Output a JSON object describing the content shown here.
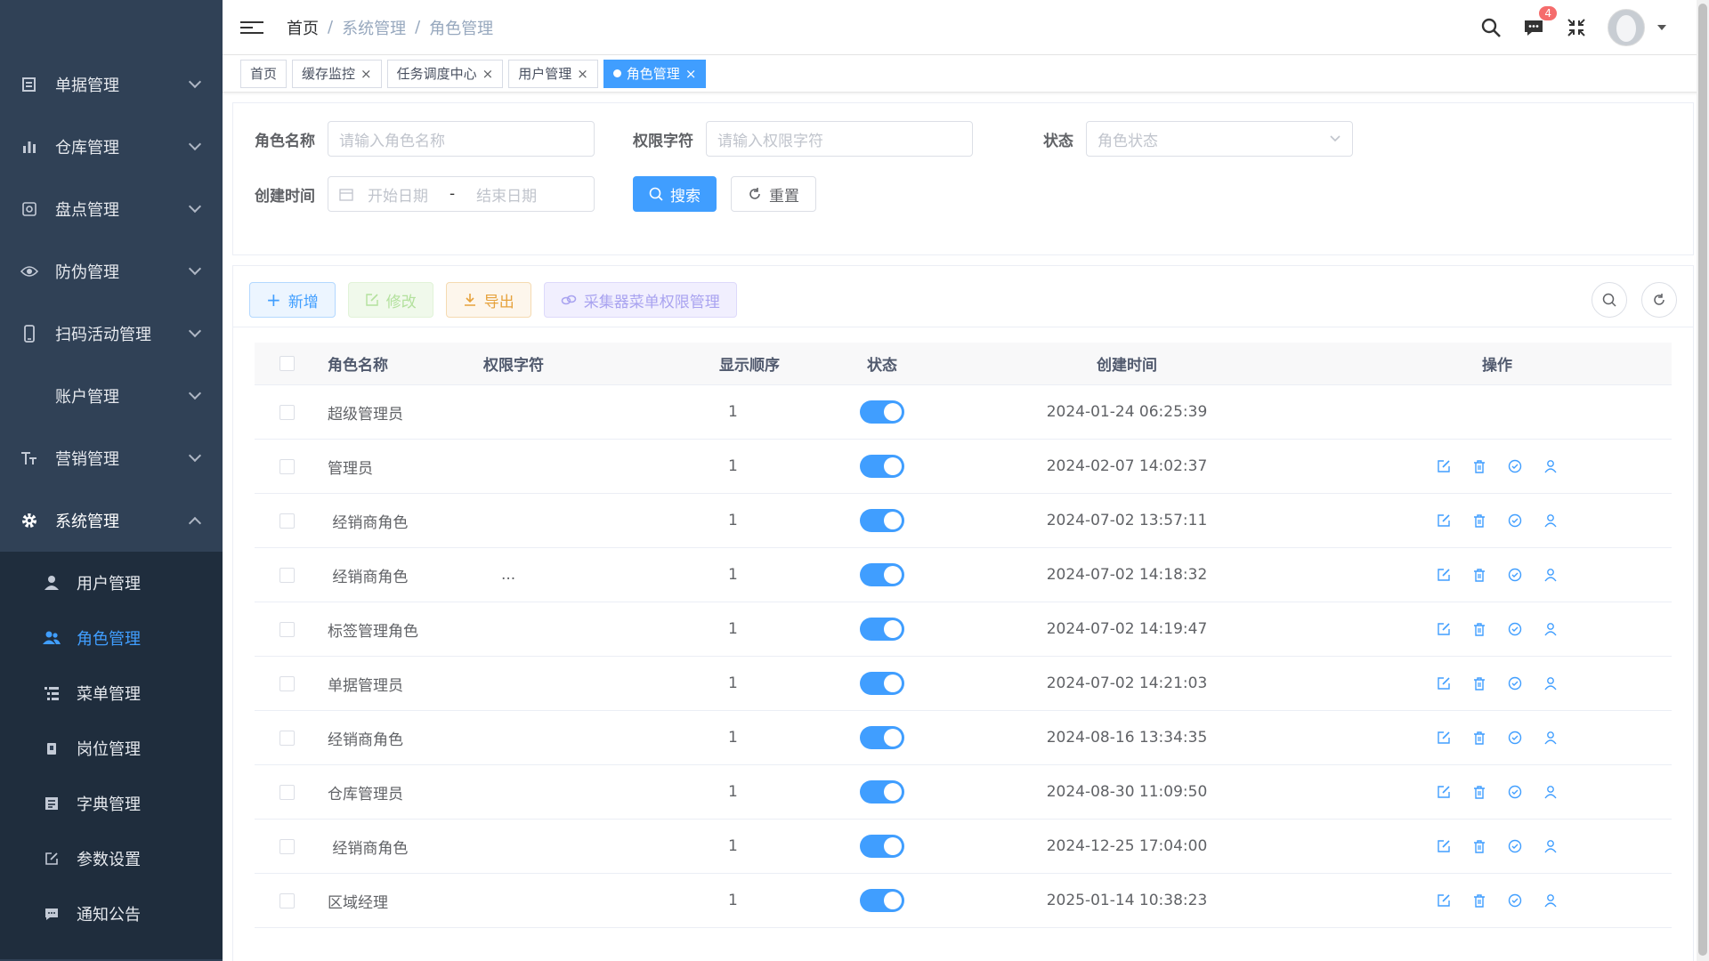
{
  "sidebar": {
    "items": [
      {
        "label": "单据管理",
        "icon": "document-icon"
      },
      {
        "label": "仓库管理",
        "icon": "bar-chart-icon"
      },
      {
        "label": "盘点管理",
        "icon": "target-icon"
      },
      {
        "label": "防伪管理",
        "icon": "eye-icon"
      },
      {
        "label": "扫码活动管理",
        "icon": "phone-icon"
      },
      {
        "label": "账户管理",
        "icon": ""
      },
      {
        "label": "营销管理",
        "icon": "text-size-icon"
      },
      {
        "label": "系统管理",
        "icon": "gear-icon"
      }
    ],
    "submenu": [
      {
        "label": "用户管理",
        "icon": "user-icon"
      },
      {
        "label": "角色管理",
        "icon": "users-icon"
      },
      {
        "label": "菜单管理",
        "icon": "tree-list-icon"
      },
      {
        "label": "岗位管理",
        "icon": "post-icon"
      },
      {
        "label": "字典管理",
        "icon": "dictionary-icon"
      },
      {
        "label": "参数设置",
        "icon": "edit-icon"
      },
      {
        "label": "通知公告",
        "icon": "message-icon"
      }
    ]
  },
  "header": {
    "breadcrumb": [
      "首页",
      "系统管理",
      "角色管理"
    ],
    "notification_count": "4"
  },
  "tags": [
    {
      "label": "首页",
      "closable": false,
      "active": false
    },
    {
      "label": "缓存监控",
      "closable": true,
      "active": false
    },
    {
      "label": "任务调度中心",
      "closable": true,
      "active": false
    },
    {
      "label": "用户管理",
      "closable": true,
      "active": false
    },
    {
      "label": "角色管理",
      "closable": true,
      "active": true
    }
  ],
  "search": {
    "role_name_label": "角色名称",
    "role_name_placeholder": "请输入角色名称",
    "role_key_label": "权限字符",
    "role_key_placeholder": "请输入权限字符",
    "status_label": "状态",
    "status_placeholder": "角色状态",
    "created_label": "创建时间",
    "start_placeholder": "开始日期",
    "date_separator": "-",
    "end_placeholder": "结束日期",
    "search_button": "搜索",
    "reset_button": "重置"
  },
  "toolbar": {
    "add": "新增",
    "edit": "修改",
    "export": "导出",
    "collector_perm": "采集器菜单权限管理"
  },
  "table": {
    "columns": [
      "角色名称",
      "权限字符",
      "显示顺序",
      "状态",
      "创建时间",
      "操作"
    ],
    "rows": [
      {
        "name": "超级管理员",
        "key": "",
        "sort": "1",
        "time": "2024-01-24 06:25:39",
        "ops": false
      },
      {
        "name": "管理员",
        "key": "",
        "sort": "1",
        "time": "2024-02-07 14:02:37",
        "ops": true
      },
      {
        "name": " 经销商角色",
        "key": "",
        "sort": "1",
        "time": "2024-07-02 13:57:11",
        "ops": true
      },
      {
        "name": " 经销商角色",
        "key": "...",
        "sort": "1",
        "time": "2024-07-02 14:18:32",
        "ops": true
      },
      {
        "name": "标签管理角色",
        "key": "",
        "sort": "1",
        "time": "2024-07-02 14:19:47",
        "ops": true
      },
      {
        "name": "单据管理员",
        "key": "",
        "sort": "1",
        "time": "2024-07-02 14:21:03",
        "ops": true
      },
      {
        "name": "经销商角色",
        "key": "",
        "sort": "1",
        "time": "2024-08-16 13:34:35",
        "ops": true
      },
      {
        "name": "仓库管理员",
        "key": "",
        "sort": "1",
        "time": "2024-08-30 11:09:50",
        "ops": true
      },
      {
        "name": " 经销商角色",
        "key": "",
        "sort": "1",
        "time": "2024-12-25 17:04:00",
        "ops": true
      },
      {
        "name": "区域经理",
        "key": "",
        "sort": "1",
        "time": "2025-01-14 10:38:23",
        "ops": true
      }
    ]
  },
  "colors": {
    "accent": "#409eff",
    "sidebar": "#304156",
    "submenu": "#1f2d3d"
  }
}
